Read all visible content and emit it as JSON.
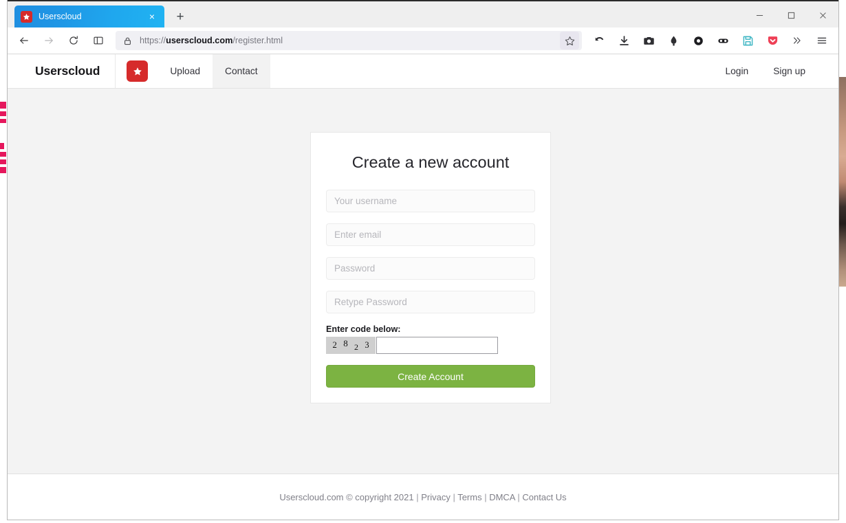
{
  "window": {
    "minimize_label": "minimize-icon",
    "maximize_label": "maximize-icon",
    "close_label": "close-icon"
  },
  "browser": {
    "tab": {
      "title": "Userscloud",
      "favicon": "star-icon",
      "close_label": "×"
    },
    "new_tab_label": "+",
    "toolbar": {
      "back_icon": "back-arrow-icon",
      "forward_icon": "forward-arrow-icon",
      "reload_icon": "reload-icon",
      "sidebar_icon": "sidebar-panel-icon",
      "lock_icon": "padlock-icon",
      "url_prefix": "https://",
      "url_domain": "userscloud.com",
      "url_path": "/register.html",
      "url_full": "https://userscloud.com/register.html",
      "bookmark_icon": "star-outline-icon",
      "extensions": [
        {
          "name": "undo-icon"
        },
        {
          "name": "download-icon"
        },
        {
          "name": "camera-icon"
        },
        {
          "name": "ink-drop-icon"
        },
        {
          "name": "circle-ring-icon"
        },
        {
          "name": "goggles-icon"
        },
        {
          "name": "floppy-save-icon",
          "color": "#3fb6c4"
        },
        {
          "name": "pocket-icon",
          "color": "#ee4056"
        }
      ],
      "overflow_icon": "chevron-double-right-icon",
      "menu_icon": "hamburger-menu-icon"
    }
  },
  "site": {
    "header": {
      "brand": "Userscloud",
      "logo_icon": "star-icon",
      "logo_color": "#d62b2b",
      "nav_left": [
        {
          "label": "Upload",
          "active": false
        },
        {
          "label": "Contact",
          "active": true
        }
      ],
      "nav_right": [
        {
          "label": "Login"
        },
        {
          "label": "Sign up"
        }
      ]
    },
    "register_card": {
      "title": "Create a new account",
      "fields": [
        {
          "name": "username",
          "placeholder": "Your username",
          "value": "",
          "type": "text"
        },
        {
          "name": "email",
          "placeholder": "Enter email",
          "value": "",
          "type": "text"
        },
        {
          "name": "password",
          "placeholder": "Password",
          "value": "",
          "type": "text"
        },
        {
          "name": "retype-password",
          "placeholder": "Retype Password",
          "value": "",
          "type": "text"
        }
      ],
      "captcha": {
        "label": "Enter code below:",
        "code_digits": [
          "2",
          "8",
          "2",
          "3"
        ],
        "code": "2823",
        "input_value": "",
        "input_placeholder": ""
      },
      "submit_label": "Create Account",
      "submit_color": "#7cb342"
    },
    "footer": {
      "copyright": "Userscloud.com © copyright 2021",
      "separator": " | ",
      "links": [
        "Privacy",
        "Terms",
        "DMCA",
        "Contact Us"
      ],
      "full_text": "Userscloud.com © copyright 2021 | Privacy | Terms | DMCA | Contact Us"
    }
  }
}
